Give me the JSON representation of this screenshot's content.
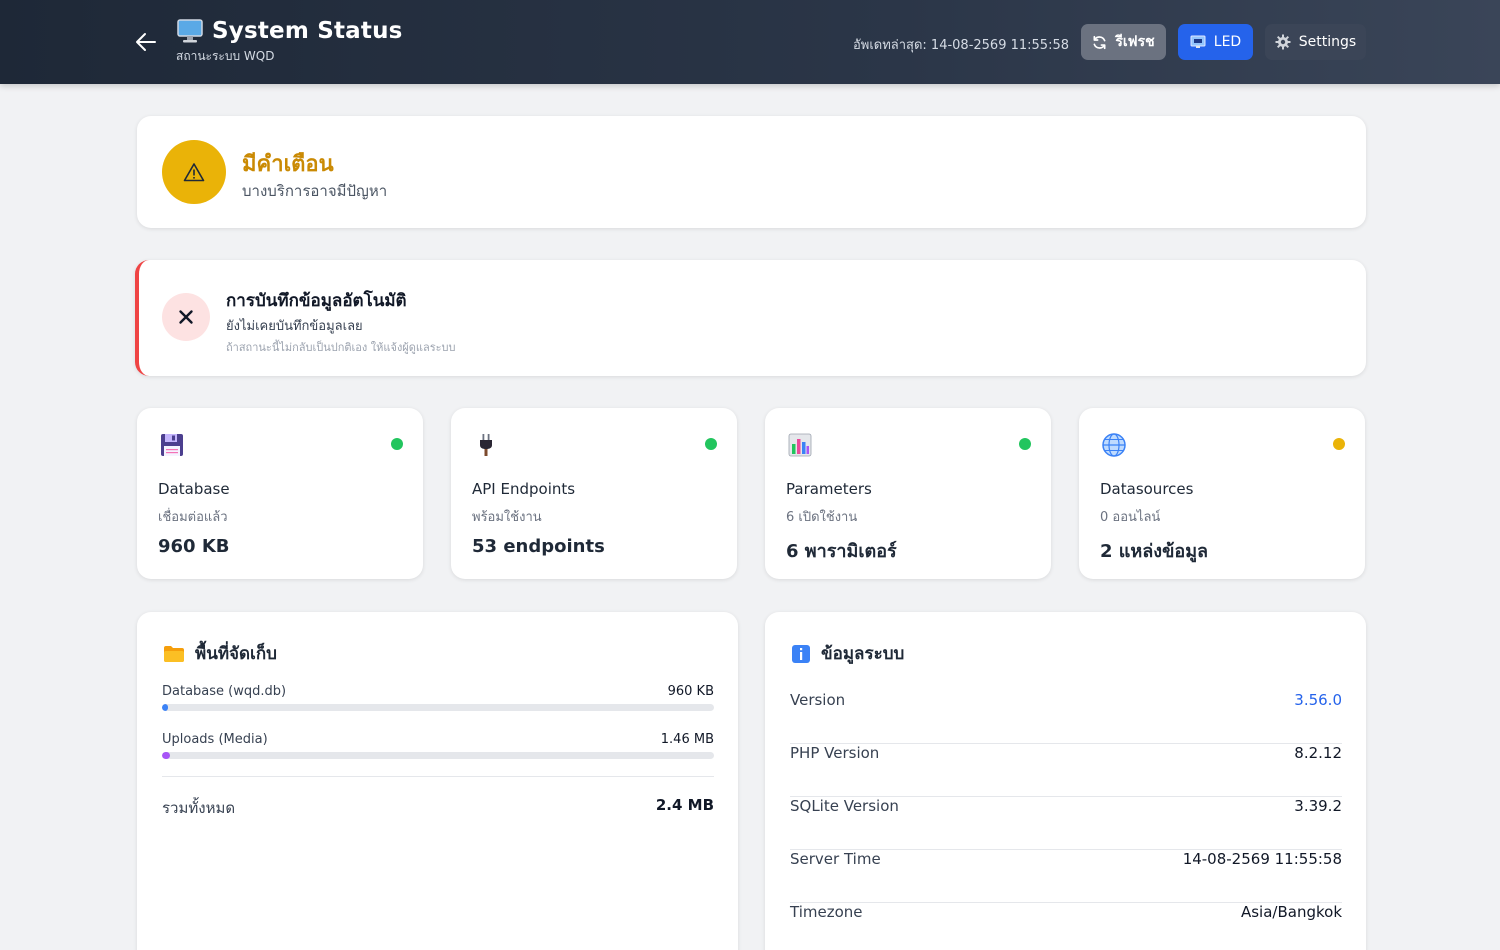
{
  "header": {
    "title": "System Status",
    "subtitle": "สถานะระบบ WQD",
    "last_update": "อัพเดทล่าสุด: 14-08-2569 11:55:58",
    "refresh_label": "รีเฟรช",
    "led_label": "LED",
    "settings_label": "Settings"
  },
  "warning": {
    "title": "มีคำเตือน",
    "subtitle": "บางบริการอาจมีปัญหา"
  },
  "error": {
    "title": "การบันทึกข้อมูลอัตโนมัติ",
    "subtitle": "ยังไม่เคยบันทึกข้อมูลเลย",
    "note": "ถ้าสถานะนี้ไม่กลับเป็นปกติเอง ให้แจ้งผู้ดูแลระบบ"
  },
  "stats": [
    {
      "icon": "floppy-disk-icon",
      "title": "Database",
      "subtitle": "เชื่อมต่อแล้ว",
      "value": "960 KB",
      "status_color": "#22c55e"
    },
    {
      "icon": "plug-icon",
      "title": "API Endpoints",
      "subtitle": "พร้อมใช้งาน",
      "value": "53 endpoints",
      "status_color": "#22c55e"
    },
    {
      "icon": "bar-chart-icon",
      "title": "Parameters",
      "subtitle": "6 เปิดใช้งาน",
      "value": "6 พารามิเตอร์",
      "status_color": "#22c55e"
    },
    {
      "icon": "globe-icon",
      "title": "Datasources",
      "subtitle": "0 ออนไลน์",
      "value": "2 แหล่งข้อมูล",
      "status_color": "#eab308"
    }
  ],
  "storage": {
    "title": "พื้นที่จัดเก็บ",
    "items": [
      {
        "label": "Database (wqd.db)",
        "value": "960 KB",
        "fill_percent": 1,
        "color": "#3b82f6"
      },
      {
        "label": "Uploads (Media)",
        "value": "1.46 MB",
        "fill_percent": 1.5,
        "color": "#a855f7"
      }
    ],
    "total_label": "รวมทั้งหมด",
    "total_value": "2.4 MB"
  },
  "system_info": {
    "title": "ข้อมูลระบบ",
    "rows": [
      {
        "key": "Version",
        "value": "3.56.0"
      },
      {
        "key": "PHP Version",
        "value": "8.2.12"
      },
      {
        "key": "SQLite Version",
        "value": "3.39.2"
      },
      {
        "key": "Server Time",
        "value": "14-08-2569 11:55:58"
      },
      {
        "key": "Timezone",
        "value": "Asia/Bangkok"
      }
    ]
  },
  "colors": {
    "header_bg": "#1e2837",
    "accent_blue": "#2563eb",
    "warning": "#eab308",
    "error": "#ef4444",
    "ok": "#22c55e"
  }
}
